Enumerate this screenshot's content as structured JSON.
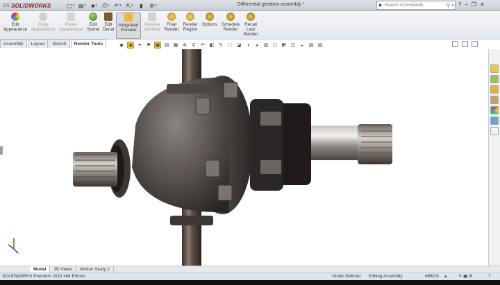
{
  "app": {
    "name": "SOLIDWORKS",
    "brand_prefix": "DS",
    "document_title": "Differential gearbox assembly *"
  },
  "search": {
    "placeholder": "Search Commands"
  },
  "ribbon": {
    "buttons": [
      {
        "label": "Edit\nAppearance",
        "enabled": true
      },
      {
        "label": "Copy\nAppearance",
        "enabled": false
      },
      {
        "label": "Paste\nAppearance",
        "enabled": false
      },
      {
        "label": "Edit\nScene",
        "enabled": true
      },
      {
        "label": "Edit\nDecal",
        "enabled": true
      },
      {
        "label": "Integrated\nPreview",
        "enabled": true,
        "active": true
      },
      {
        "label": "Preview\nWindow",
        "enabled": false
      },
      {
        "label": "Final\nRender",
        "enabled": true
      },
      {
        "label": "Render\nRegion",
        "enabled": true
      },
      {
        "label": "Options",
        "enabled": true
      },
      {
        "label": "Schedule\nRender",
        "enabled": true
      },
      {
        "label": "Recall\nLast\nRender",
        "enabled": true
      }
    ]
  },
  "tabs": [
    {
      "label": "Assembly",
      "active": false
    },
    {
      "label": "Layout",
      "active": false
    },
    {
      "label": "Sketch",
      "active": false
    },
    {
      "label": "Render Tools",
      "active": true
    }
  ],
  "bottom_tabs": [
    {
      "label": "Model",
      "active": true
    },
    {
      "label": "3D Views",
      "active": false
    },
    {
      "label": "Motion Study 2",
      "active": false
    }
  ],
  "status": {
    "edition": "SOLIDWORKS Premium 2015 x64 Edition",
    "definition": "Under Defined",
    "mode": "Editing Assembly",
    "units": "MMGS"
  },
  "colors": {
    "accent": "#f3c64a",
    "brand": "#7a1a1a",
    "part_shading": "#5e5854",
    "shaft": "#4a403a"
  },
  "icons": {
    "quick_access": [
      "new-icon",
      "open-icon",
      "save-icon",
      "print-icon",
      "undo-icon",
      "select-icon",
      "rebuild-icon",
      "options-icon"
    ],
    "title_right": [
      "help-icon",
      "minimize-icon",
      "restore-icon",
      "close-icon"
    ]
  }
}
